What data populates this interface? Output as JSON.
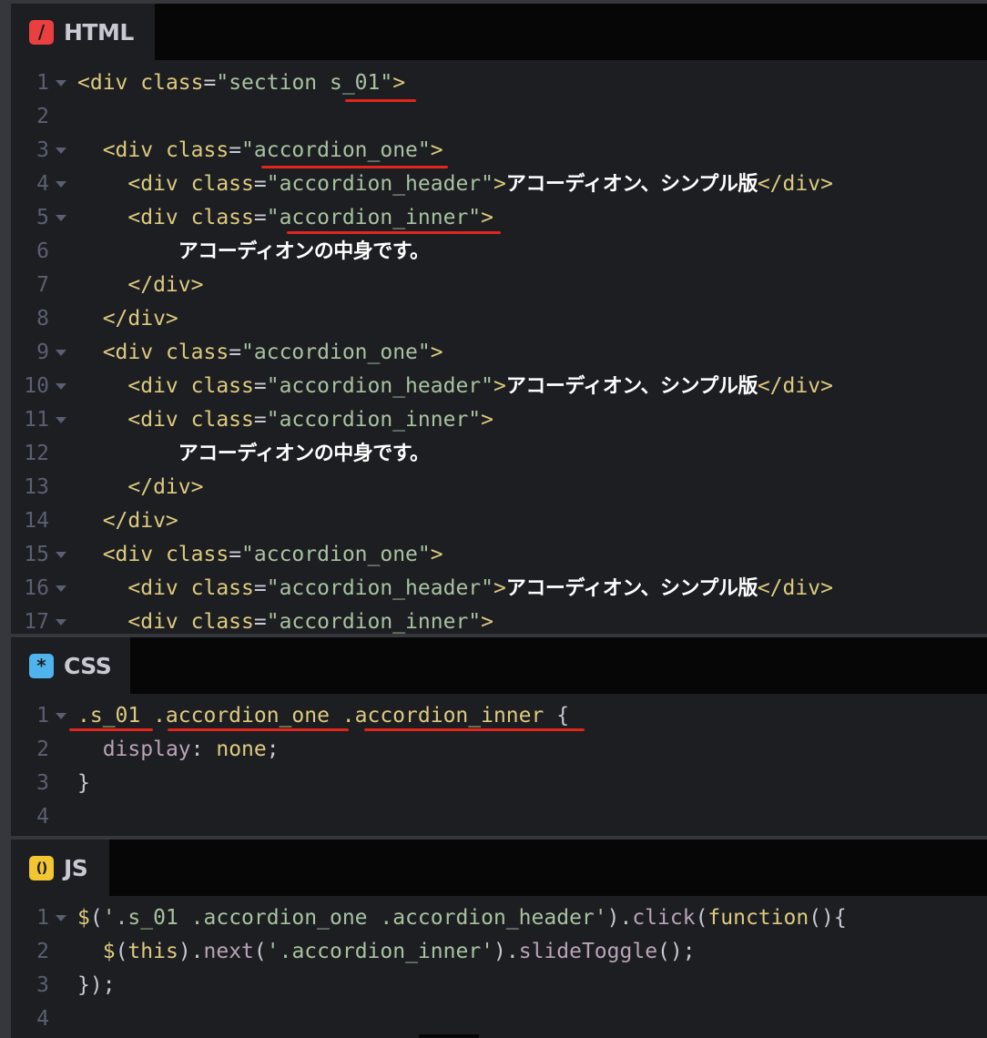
{
  "panels": {
    "html": {
      "label": "HTML",
      "badge": "/",
      "badge_color": "#e93f3f",
      "lines": [
        {
          "n": "1",
          "fold": true,
          "parts": [
            [
              "t-tag",
              "<div "
            ],
            [
              "t-attr",
              "class"
            ],
            [
              "t-eq",
              "="
            ],
            [
              "t-str",
              "\"section s_01\""
            ],
            [
              "t-tag",
              ">"
            ]
          ]
        },
        {
          "n": "2",
          "fold": false,
          "parts": []
        },
        {
          "n": "3",
          "fold": true,
          "parts": [
            [
              "t-tag",
              "  <div "
            ],
            [
              "t-attr",
              "class"
            ],
            [
              "t-eq",
              "="
            ],
            [
              "t-str",
              "\"accordion_one\""
            ],
            [
              "t-tag",
              ">"
            ]
          ]
        },
        {
          "n": "4",
          "fold": true,
          "parts": [
            [
              "t-tag",
              "    <div "
            ],
            [
              "t-attr",
              "class"
            ],
            [
              "t-eq",
              "="
            ],
            [
              "t-str",
              "\"accordion_header\""
            ],
            [
              "t-tag",
              ">"
            ],
            [
              "t-jp",
              "アコーディオン、シンプル版"
            ],
            [
              "t-tag",
              "</div>"
            ]
          ]
        },
        {
          "n": "5",
          "fold": true,
          "parts": [
            [
              "t-tag",
              "    <div "
            ],
            [
              "t-attr",
              "class"
            ],
            [
              "t-eq",
              "="
            ],
            [
              "t-str",
              "\"accordion_inner\""
            ],
            [
              "t-tag",
              ">"
            ]
          ]
        },
        {
          "n": "6",
          "fold": false,
          "parts": [
            [
              "t-punc",
              "        "
            ],
            [
              "t-jp",
              "アコーディオンの中身です。"
            ]
          ]
        },
        {
          "n": "7",
          "fold": false,
          "parts": [
            [
              "t-tag",
              "    </div>"
            ]
          ]
        },
        {
          "n": "8",
          "fold": false,
          "parts": [
            [
              "t-tag",
              "  </div>"
            ]
          ]
        },
        {
          "n": "9",
          "fold": true,
          "parts": [
            [
              "t-tag",
              "  <div "
            ],
            [
              "t-attr",
              "class"
            ],
            [
              "t-eq",
              "="
            ],
            [
              "t-str",
              "\"accordion_one\""
            ],
            [
              "t-tag",
              ">"
            ]
          ]
        },
        {
          "n": "10",
          "fold": true,
          "parts": [
            [
              "t-tag",
              "    <div "
            ],
            [
              "t-attr",
              "class"
            ],
            [
              "t-eq",
              "="
            ],
            [
              "t-str",
              "\"accordion_header\""
            ],
            [
              "t-tag",
              ">"
            ],
            [
              "t-jp",
              "アコーディオン、シンプル版"
            ],
            [
              "t-tag",
              "</div>"
            ]
          ]
        },
        {
          "n": "11",
          "fold": true,
          "parts": [
            [
              "t-tag",
              "    <div "
            ],
            [
              "t-attr",
              "class"
            ],
            [
              "t-eq",
              "="
            ],
            [
              "t-str",
              "\"accordion_inner\""
            ],
            [
              "t-tag",
              ">"
            ]
          ]
        },
        {
          "n": "12",
          "fold": false,
          "parts": [
            [
              "t-punc",
              "        "
            ],
            [
              "t-jp",
              "アコーディオンの中身です。"
            ]
          ]
        },
        {
          "n": "13",
          "fold": false,
          "parts": [
            [
              "t-tag",
              "    </div>"
            ]
          ]
        },
        {
          "n": "14",
          "fold": false,
          "parts": [
            [
              "t-tag",
              "  </div>"
            ]
          ]
        },
        {
          "n": "15",
          "fold": true,
          "parts": [
            [
              "t-tag",
              "  <div "
            ],
            [
              "t-attr",
              "class"
            ],
            [
              "t-eq",
              "="
            ],
            [
              "t-str",
              "\"accordion_one\""
            ],
            [
              "t-tag",
              ">"
            ]
          ]
        },
        {
          "n": "16",
          "fold": true,
          "parts": [
            [
              "t-tag",
              "    <div "
            ],
            [
              "t-attr",
              "class"
            ],
            [
              "t-eq",
              "="
            ],
            [
              "t-str",
              "\"accordion_header\""
            ],
            [
              "t-tag",
              ">"
            ],
            [
              "t-jp",
              "アコーディオン、シンプル版"
            ],
            [
              "t-tag",
              "</div>"
            ]
          ]
        },
        {
          "n": "17",
          "fold": true,
          "parts": [
            [
              "t-tag",
              "    <div "
            ],
            [
              "t-attr",
              "class"
            ],
            [
              "t-eq",
              "="
            ],
            [
              "t-str",
              "\"accordion_inner\""
            ],
            [
              "t-tag",
              ">"
            ]
          ]
        }
      ]
    },
    "css": {
      "label": "CSS",
      "badge": "*",
      "badge_color": "#4fb3ec",
      "lines": [
        {
          "n": "1",
          "fold": true,
          "parts": [
            [
              "t-sel",
              ".s_01 .accordion_one .accordion_inner "
            ],
            [
              "t-punc",
              "{"
            ]
          ]
        },
        {
          "n": "2",
          "fold": false,
          "parts": [
            [
              "t-punc",
              "  "
            ],
            [
              "t-prop",
              "display"
            ],
            [
              "t-punc",
              ": "
            ],
            [
              "t-val",
              "none"
            ],
            [
              "t-punc",
              ";"
            ]
          ]
        },
        {
          "n": "3",
          "fold": false,
          "parts": [
            [
              "t-punc",
              "}"
            ]
          ]
        },
        {
          "n": "4",
          "fold": false,
          "parts": []
        }
      ]
    },
    "js": {
      "label": "JS",
      "badge": "()",
      "badge_color": "#f2c531",
      "lines": [
        {
          "n": "1",
          "fold": true,
          "parts": [
            [
              "t-fn",
              "$"
            ],
            [
              "t-punc",
              "("
            ],
            [
              "t-str",
              "'.s_01 .accordion_one .accordion_header'"
            ],
            [
              "t-punc",
              ")."
            ],
            [
              "t-meth",
              "click"
            ],
            [
              "t-punc",
              "("
            ],
            [
              "t-fn",
              "function"
            ],
            [
              "t-punc",
              "(){"
            ]
          ]
        },
        {
          "n": "2",
          "fold": false,
          "parts": [
            [
              "t-punc",
              "  "
            ],
            [
              "t-fn",
              "$"
            ],
            [
              "t-punc",
              "("
            ],
            [
              "t-fn",
              "this"
            ],
            [
              "t-punc",
              ")."
            ],
            [
              "t-meth",
              "next"
            ],
            [
              "t-punc",
              "("
            ],
            [
              "t-str",
              "'.accordion_inner'"
            ],
            [
              "t-punc",
              ")."
            ],
            [
              "t-meth",
              "slideToggle"
            ],
            [
              "t-punc",
              "();"
            ]
          ]
        },
        {
          "n": "3",
          "fold": false,
          "parts": [
            [
              "t-punc",
              "});"
            ]
          ]
        },
        {
          "n": "4",
          "fold": false,
          "parts": []
        }
      ]
    }
  }
}
